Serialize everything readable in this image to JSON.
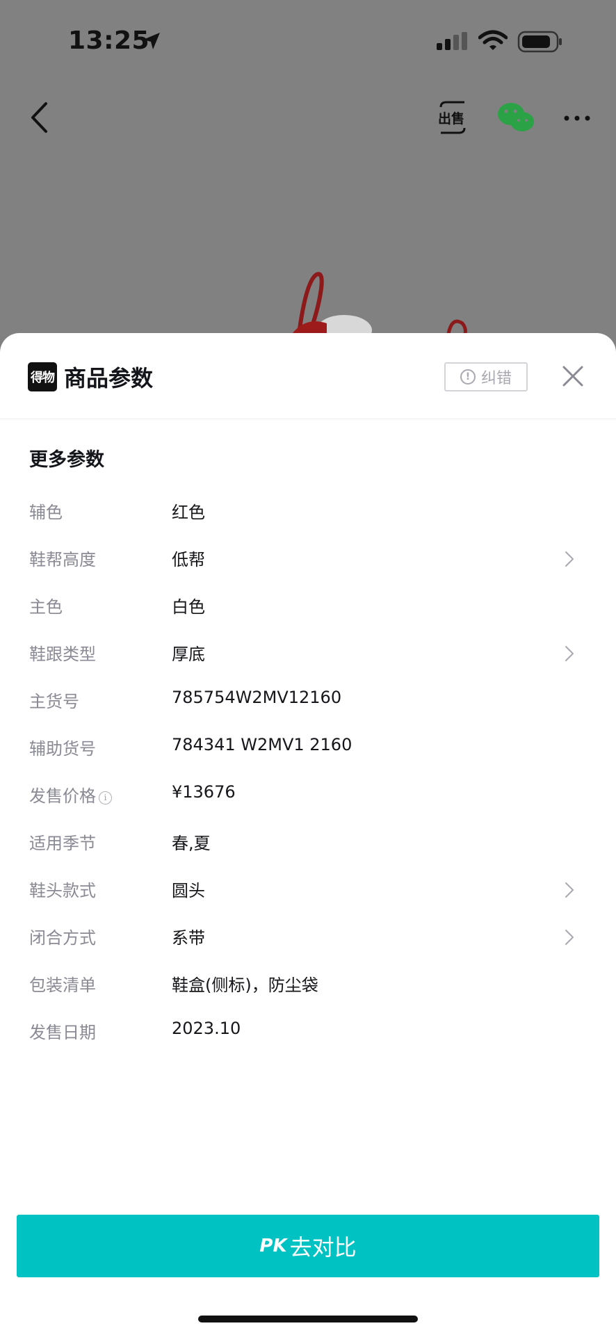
{
  "status_bar": {
    "time": "13:25",
    "icons": [
      "location-arrow-icon",
      "signal-icon",
      "wifi-icon",
      "battery-icon"
    ]
  },
  "nav": {
    "icons": [
      "back-icon",
      "sell-icon",
      "wechat-icon",
      "more-icon"
    ],
    "sell_label": "出售"
  },
  "sheet": {
    "brand_logo": "得物",
    "title": "商品参数",
    "report_label": "纠错",
    "section_title": "更多参数",
    "params": [
      {
        "label": "辅色",
        "value": "红色",
        "has_arrow": false
      },
      {
        "label": "鞋帮高度",
        "value": "低帮",
        "has_arrow": true
      },
      {
        "label": "主色",
        "value": "白色",
        "has_arrow": false
      },
      {
        "label": "鞋跟类型",
        "value": "厚底",
        "has_arrow": true
      },
      {
        "label": "主货号",
        "value": "785754W2MV12160",
        "has_arrow": false
      },
      {
        "label": "辅助货号",
        "value": "784341 W2MV1 2160",
        "has_arrow": false
      },
      {
        "label": "发售价格",
        "value": "¥13676",
        "has_arrow": false,
        "has_tip": true
      },
      {
        "label": "适用季节",
        "value": "春,夏",
        "has_arrow": false
      },
      {
        "label": "鞋头款式",
        "value": "圆头",
        "has_arrow": true
      },
      {
        "label": "闭合方式",
        "value": "系带",
        "has_arrow": true
      },
      {
        "label": "包装清单",
        "value": "鞋盒(侧标)，防尘袋",
        "has_arrow": false
      },
      {
        "label": "发售日期",
        "value": "2023.10",
        "has_arrow": false
      }
    ]
  },
  "pk_button": {
    "prefix": "PK",
    "label": "去对比"
  },
  "colors": {
    "accent": "#01c2c3",
    "overlay": "#818181",
    "label": "#8a8a94",
    "value": "#16161a"
  }
}
